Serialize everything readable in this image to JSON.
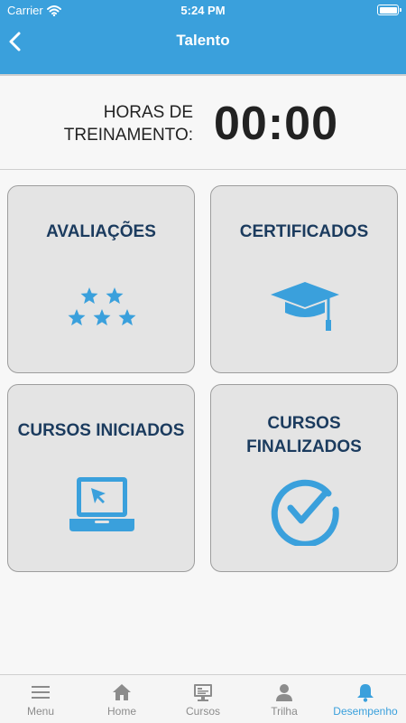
{
  "status_bar": {
    "carrier": "Carrier",
    "time": "5:24 PM"
  },
  "header": {
    "title": "Talento",
    "back_icon": "chevron-left-icon"
  },
  "hours": {
    "label_line1": "HORAS DE",
    "label_line2": "TREINAMENTO:",
    "value": "00:00"
  },
  "cards": [
    {
      "title": "AVALIAÇÕES",
      "icon": "stars-icon"
    },
    {
      "title": "CERTIFICADOS",
      "icon": "graduation-cap-icon"
    },
    {
      "title": "CURSOS INICIADOS",
      "icon": "laptop-cursor-icon"
    },
    {
      "title_line1": "CURSOS",
      "title_line2": "FINALIZADOS",
      "icon": "check-circle-icon"
    }
  ],
  "tabs": [
    {
      "label": "Menu",
      "icon": "menu-icon"
    },
    {
      "label": "Home",
      "icon": "home-icon"
    },
    {
      "label": "Cursos",
      "icon": "courses-icon"
    },
    {
      "label": "Trilha",
      "icon": "person-icon"
    },
    {
      "label": "Desempenho",
      "icon": "bell-icon",
      "active": true
    }
  ],
  "colors": {
    "accent": "#3aa0dc",
    "card_title": "#1b3b5e",
    "card_bg": "#e4e4e4",
    "inactive": "#8c8c8c"
  }
}
